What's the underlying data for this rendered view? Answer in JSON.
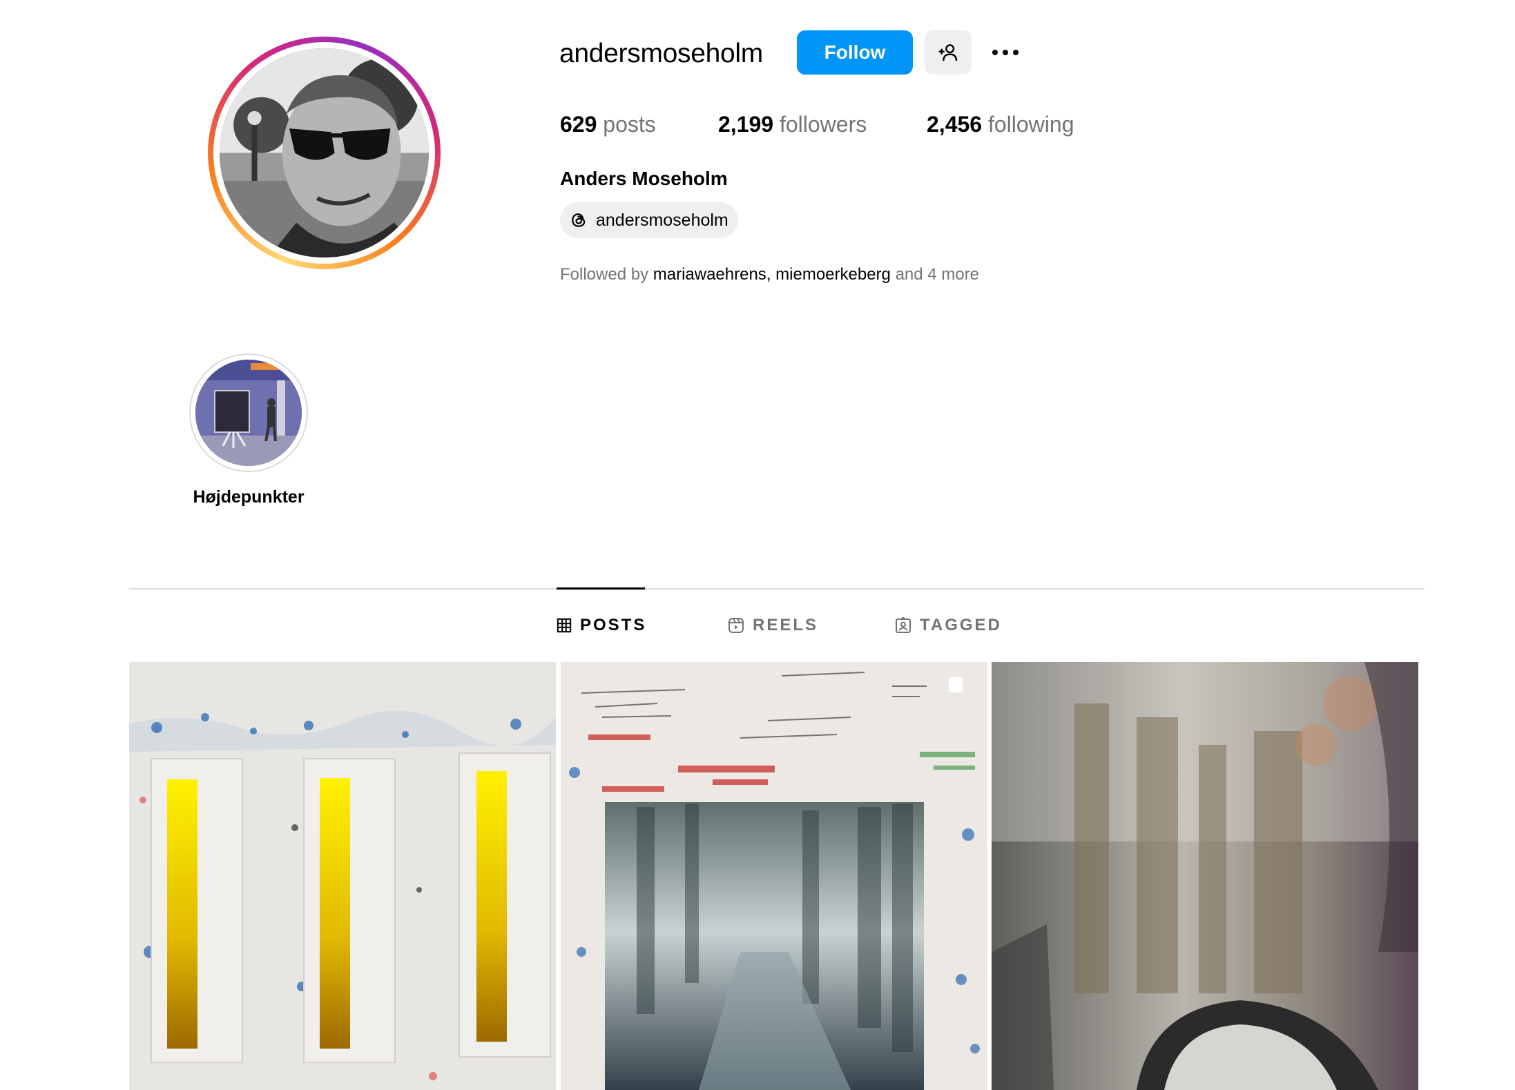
{
  "profile": {
    "username": "andersmoseholm",
    "full_name": "Anders Moseholm",
    "threads_handle": "andersmoseholm",
    "avatar_alt": "Profile photo",
    "follow_label": "Follow",
    "stats": {
      "posts_count": "629",
      "posts_label": "posts",
      "followers_count": "2,199",
      "followers_label": "followers",
      "following_count": "2,456",
      "following_label": "following"
    },
    "followed_by": {
      "prefix": "Followed by",
      "user1": "mariawaehrens",
      "separator": ",",
      "user2": "miemoerkeberg",
      "suffix": "and 4 more"
    }
  },
  "highlights": [
    {
      "label": "Højdepunkter"
    }
  ],
  "tabs": [
    {
      "label": "POSTS",
      "icon": "grid-icon",
      "active": true
    },
    {
      "label": "REELS",
      "icon": "reels-icon",
      "active": false
    },
    {
      "label": "TAGGED",
      "icon": "tagged-icon",
      "active": false
    }
  ],
  "posts": [
    {
      "description": "three-yellow-gradient-panels"
    },
    {
      "description": "foggy-forest-painting-on-graffiti-wall",
      "multi": true
    },
    {
      "description": "misty-abstract-painting"
    }
  ],
  "colors": {
    "accent": "#0095f6",
    "secondary_text": "#737373",
    "button_bg": "#efefef",
    "divider": "#dbdbdb"
  }
}
